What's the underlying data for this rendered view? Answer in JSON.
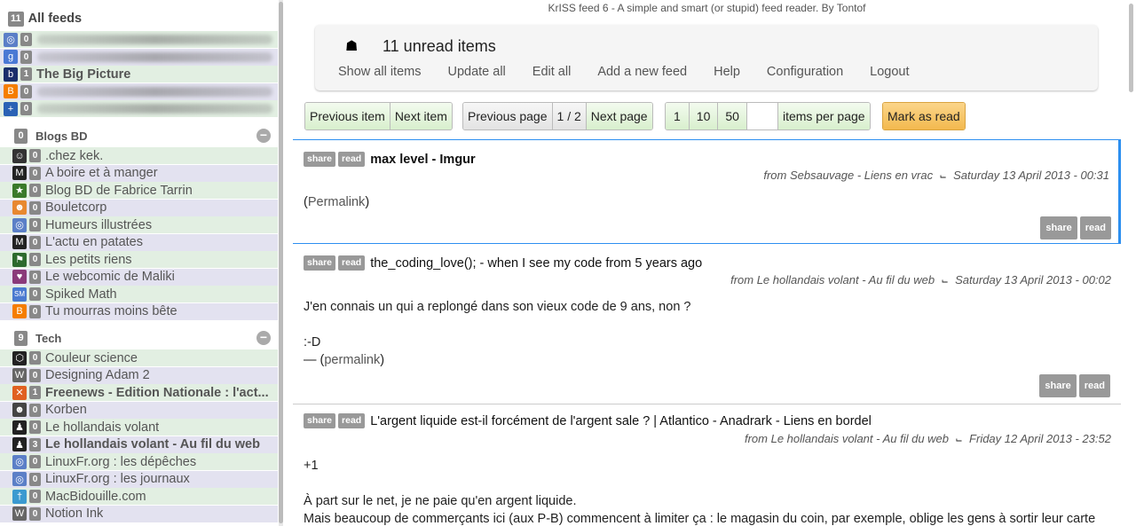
{
  "sidebar": {
    "all_feeds": {
      "count": "11",
      "label": "All feeds"
    },
    "top_feeds": [
      {
        "count": "0",
        "label": "",
        "icon": "globe-icon",
        "color": "#5b7fc7",
        "blurred": true
      },
      {
        "count": "0",
        "label": "",
        "icon": "google-plus-icon",
        "color": "#4a78d4",
        "blurred": true
      },
      {
        "count": "1",
        "label": "The Big Picture",
        "icon": "boston-globe-icon",
        "color": "#1a2f6b",
        "blurred": false
      },
      {
        "count": "0",
        "label": "",
        "icon": "blogger-icon",
        "color": "#f57d00",
        "blurred": true
      },
      {
        "count": "0",
        "label": "",
        "icon": "plus-circle-icon",
        "color": "#2a62b5",
        "blurred": true
      }
    ],
    "groups": [
      {
        "count": "0",
        "name": "Blogs BD",
        "feeds": [
          {
            "count": "0",
            "label": ".chez kek.",
            "icon": "kek-icon",
            "color": "#333"
          },
          {
            "count": "0",
            "label": "A boire et à manger",
            "icon": "m-icon",
            "color": "#222"
          },
          {
            "count": "0",
            "label": "Blog BD de Fabrice Tarrin",
            "icon": "tarrin-icon",
            "color": "#3a7a2a"
          },
          {
            "count": "0",
            "label": "Bouletcorp",
            "icon": "boulet-icon",
            "color": "#e88830"
          },
          {
            "count": "0",
            "label": "Humeurs illustrées",
            "icon": "globe-icon",
            "color": "#5b7fc7"
          },
          {
            "count": "0",
            "label": "L'actu en patates",
            "icon": "m-icon",
            "color": "#222"
          },
          {
            "count": "0",
            "label": "Les petits riens",
            "icon": "petits-riens-icon",
            "color": "#2d6a2d"
          },
          {
            "count": "0",
            "label": "Le webcomic de Maliki",
            "icon": "maliki-icon",
            "color": "#8a3a7a"
          },
          {
            "count": "0",
            "label": "Spiked Math",
            "icon": "sm-icon",
            "color": "#4a7ad0"
          },
          {
            "count": "0",
            "label": "Tu mourras moins bête",
            "icon": "blogger-icon",
            "color": "#f57d00"
          }
        ]
      },
      {
        "count": "9",
        "name": "Tech",
        "feeds": [
          {
            "count": "0",
            "label": "Couleur science",
            "icon": "hexagon-icon",
            "color": "#222",
            "bold": false
          },
          {
            "count": "0",
            "label": "Designing Adam 2",
            "icon": "wordpress-icon",
            "color": "#666",
            "bold": false
          },
          {
            "count": "1",
            "label": "Freenews - Edition Nationale : l'act...",
            "icon": "freenews-icon",
            "color": "#e06020",
            "bold": true
          },
          {
            "count": "0",
            "label": "Korben",
            "icon": "korben-icon",
            "color": "#444",
            "bold": false
          },
          {
            "count": "0",
            "label": "Le hollandais volant",
            "icon": "hollandais-icon",
            "color": "#222",
            "bold": false
          },
          {
            "count": "3",
            "label": "Le hollandais volant - Au fil du web",
            "icon": "hollandais-icon",
            "color": "#222",
            "bold": true
          },
          {
            "count": "0",
            "label": "LinuxFr.org : les dépêches",
            "icon": "globe-icon",
            "color": "#5b7fc7",
            "bold": false
          },
          {
            "count": "0",
            "label": "LinuxFr.org : les journaux",
            "icon": "globe-icon",
            "color": "#5b7fc7",
            "bold": false
          },
          {
            "count": "0",
            "label": "MacBidouille.com",
            "icon": "macbidouille-icon",
            "color": "#3a9ad0",
            "bold": false
          },
          {
            "count": "0",
            "label": "Notion Ink",
            "icon": "wordpress-icon",
            "color": "#666",
            "bold": false
          }
        ]
      }
    ]
  },
  "header": {
    "tagline_app": "KrISS feed 6",
    "tagline_text": " - A simple and smart (or stupid) feed reader. By ",
    "tagline_author": "Tontof",
    "unread_text": "11 unread items",
    "menu": [
      "Show all items",
      "Update all",
      "Edit all",
      "Add a new feed",
      "Help",
      "Configuration",
      "Logout"
    ]
  },
  "toolbar": {
    "previous_item": "Previous item",
    "next_item": "Next item",
    "previous_page": "Previous page",
    "page_indicator": "1 / 2",
    "next_page": "Next page",
    "per_page_options": [
      "1",
      "10",
      "50"
    ],
    "per_page_input": "",
    "items_per_page": "items per page",
    "mark_as_read": "Mark as read"
  },
  "items": [
    {
      "title": "max level - Imgur",
      "from": "from Sebsauvage - Liens en vrac",
      "date": "Saturday 13 April 2013 - 00:31",
      "body_open": "(",
      "body_link": "Permalink",
      "body_close": ")"
    },
    {
      "title": "the_coding_love(); - when I see my code from 5 years ago",
      "from": "from Le hollandais volant - Au fil du web",
      "date": "Saturday 13 April 2013 - 00:02",
      "line1": "J'en connais un qui a replongé dans son vieux code de 9 ans, non ?",
      "line2": ":-D",
      "line3_prefix": "— (",
      "line3_link": "permalink",
      "line3_suffix": ")"
    },
    {
      "title": "L'argent liquide est-il forcément de l'argent sale ? | Atlantico - Anadrark - Liens en bordel",
      "from": "from Le hollandais volant - Au fil du web",
      "date": "Friday 12 April 2013 - 23:52",
      "line1": "+1",
      "line2": "À part sur le net, je ne paie qu'en argent liquide.",
      "line3": "Mais beaucoup de commerçants ici (aux P-B) commencent à limiter ça : le magasin du coin, par exemple, oblige les gens à sortir leur carte"
    }
  ],
  "labels": {
    "share": "share",
    "read": "read",
    "rss_icon": "rss-icon",
    "home_icon": "home-icon"
  }
}
